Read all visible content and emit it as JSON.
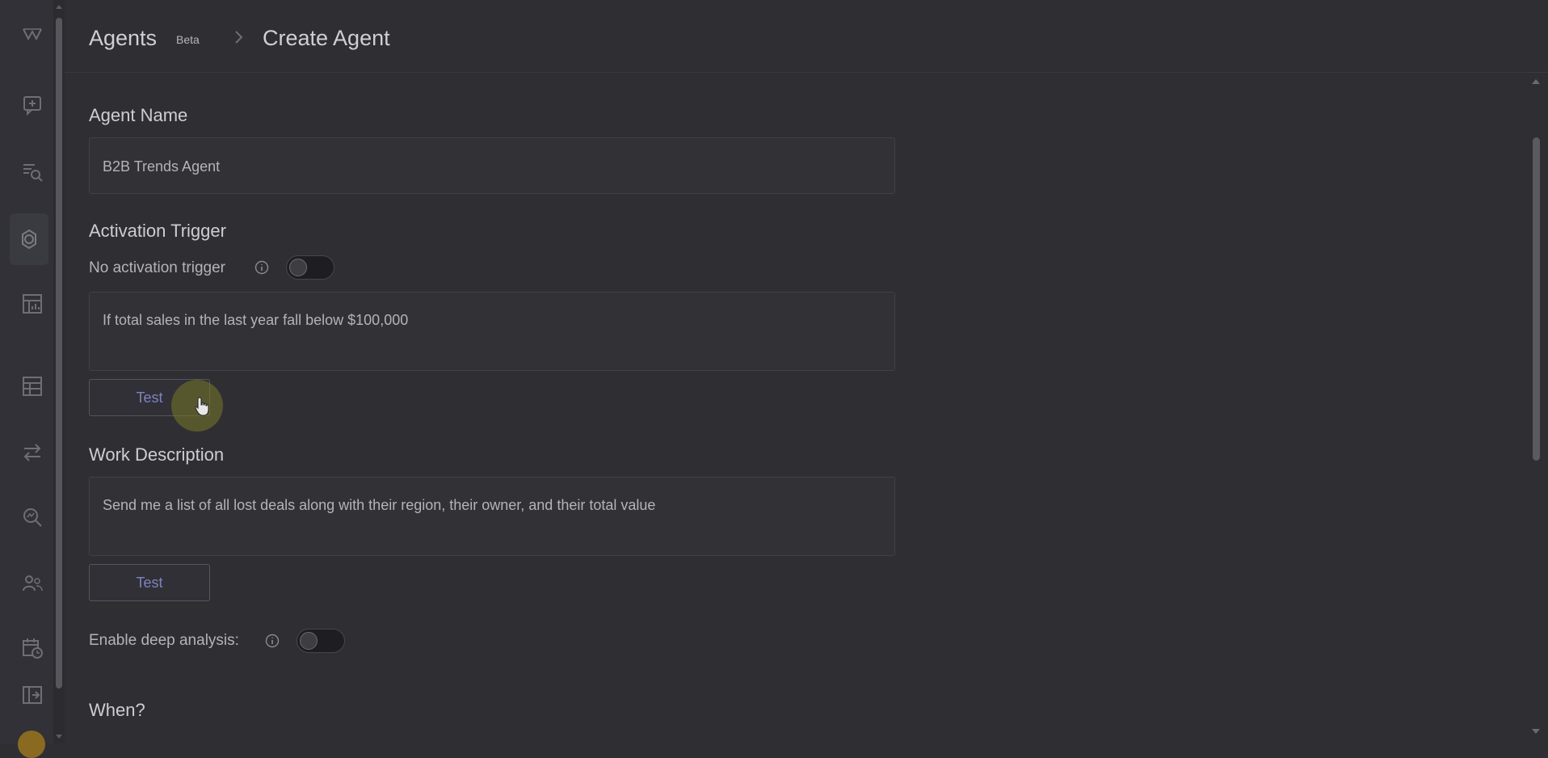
{
  "breadcrumb": {
    "root": "Agents",
    "badge": "Beta",
    "current": "Create Agent"
  },
  "rail": {
    "icons": [
      "logo-icon",
      "chat-plus-icon",
      "list-search-icon",
      "agent-gear-icon",
      "report-chart-icon",
      "table-icon",
      "transfer-arrows-icon",
      "search-analytics-icon",
      "users-icon",
      "calendar-clock-icon",
      "exit-panel-icon"
    ],
    "active": "agent-gear-icon"
  },
  "form": {
    "agent_name": {
      "label": "Agent Name",
      "value": "B2B Trends Agent"
    },
    "activation_trigger": {
      "label": "Activation Trigger",
      "toggle_label": "No activation trigger",
      "toggle_on": false,
      "value": "If total sales in the last year fall below $100,000",
      "test_label": "Test"
    },
    "work_description": {
      "label": "Work Description",
      "value": "Send me a list of all lost deals along with their region, their owner, and their total value",
      "test_label": "Test"
    },
    "deep_analysis": {
      "label": "Enable deep analysis:",
      "toggle_on": false
    },
    "when": {
      "label": "When?"
    }
  },
  "colors": {
    "background": "#2f2f33",
    "accent": "#7f82c0"
  }
}
